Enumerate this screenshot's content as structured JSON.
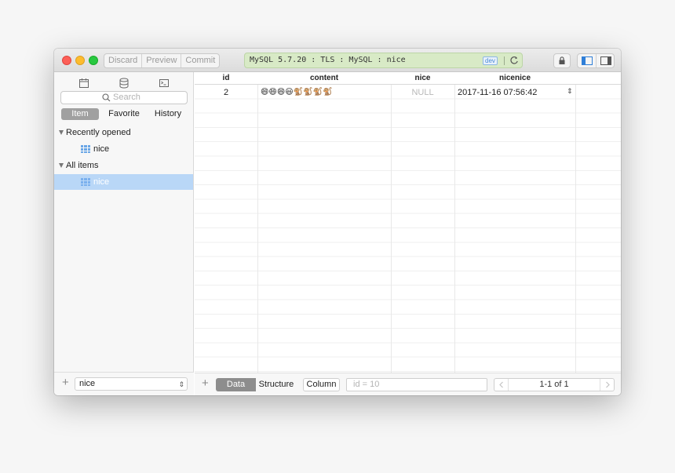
{
  "toolbar": {
    "discard_label": "Discard",
    "preview_label": "Preview",
    "commit_label": "Commit"
  },
  "connection": {
    "text": "MySQL 5.7.20 : TLS : MySQL : nice",
    "tag": "dev",
    "color": "#d8eac6"
  },
  "sidebar": {
    "search_placeholder": "Search",
    "segments": {
      "item": "Item",
      "favorite": "Favorite",
      "history": "History"
    },
    "recently_opened": {
      "label": "Recently opened",
      "items": [
        "nice"
      ]
    },
    "all_items": {
      "label": "All items",
      "items": [
        "nice"
      ]
    },
    "footer_select": "nice"
  },
  "table": {
    "columns": [
      "id",
      "content",
      "nice",
      "nicenice"
    ],
    "rows": [
      {
        "id": "2",
        "content": "😄😄😄😃🐒🐒🐒🐒",
        "nice": "NULL",
        "nicenice": "2017-11-16 07:56:42"
      }
    ]
  },
  "bottombar": {
    "data_label": "Data",
    "structure_label": "Structure",
    "column_label": "Column",
    "filter_placeholder": "id = 10",
    "pager_text": "1-1 of 1"
  },
  "colors": {
    "selection": "#b9d7f7",
    "segment_active": "#a0a0a0"
  }
}
